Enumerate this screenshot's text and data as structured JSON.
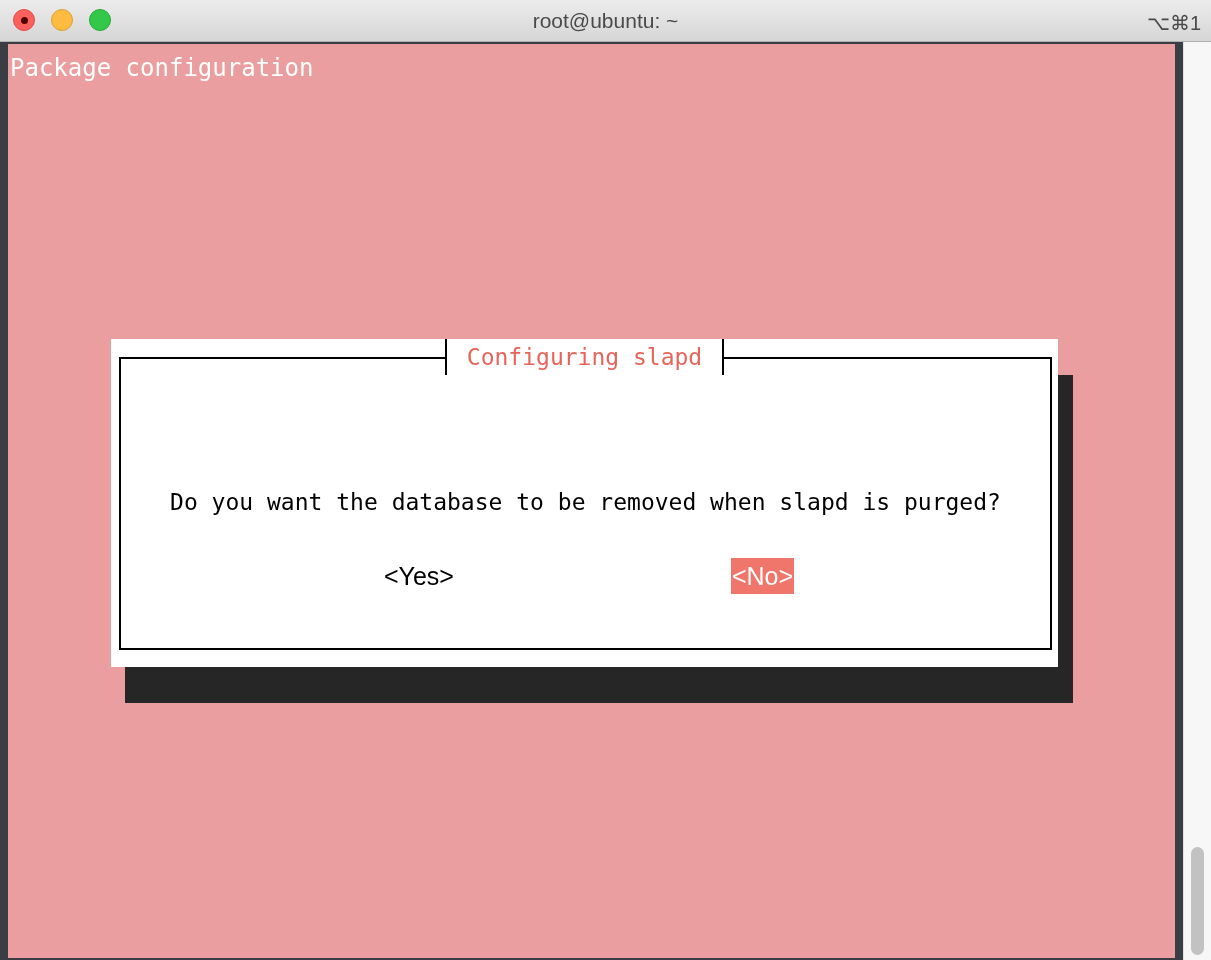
{
  "window": {
    "title": "root@ubuntu: ~",
    "shortcut": "⌥⌘1"
  },
  "terminal": {
    "header": "Package configuration"
  },
  "dialog": {
    "title": "Configuring slapd",
    "message": "Do you want the database to be removed when slapd is purged?",
    "buttons": [
      {
        "label": "<Yes>",
        "selected": false
      },
      {
        "label": "<No>",
        "selected": true
      }
    ]
  }
}
